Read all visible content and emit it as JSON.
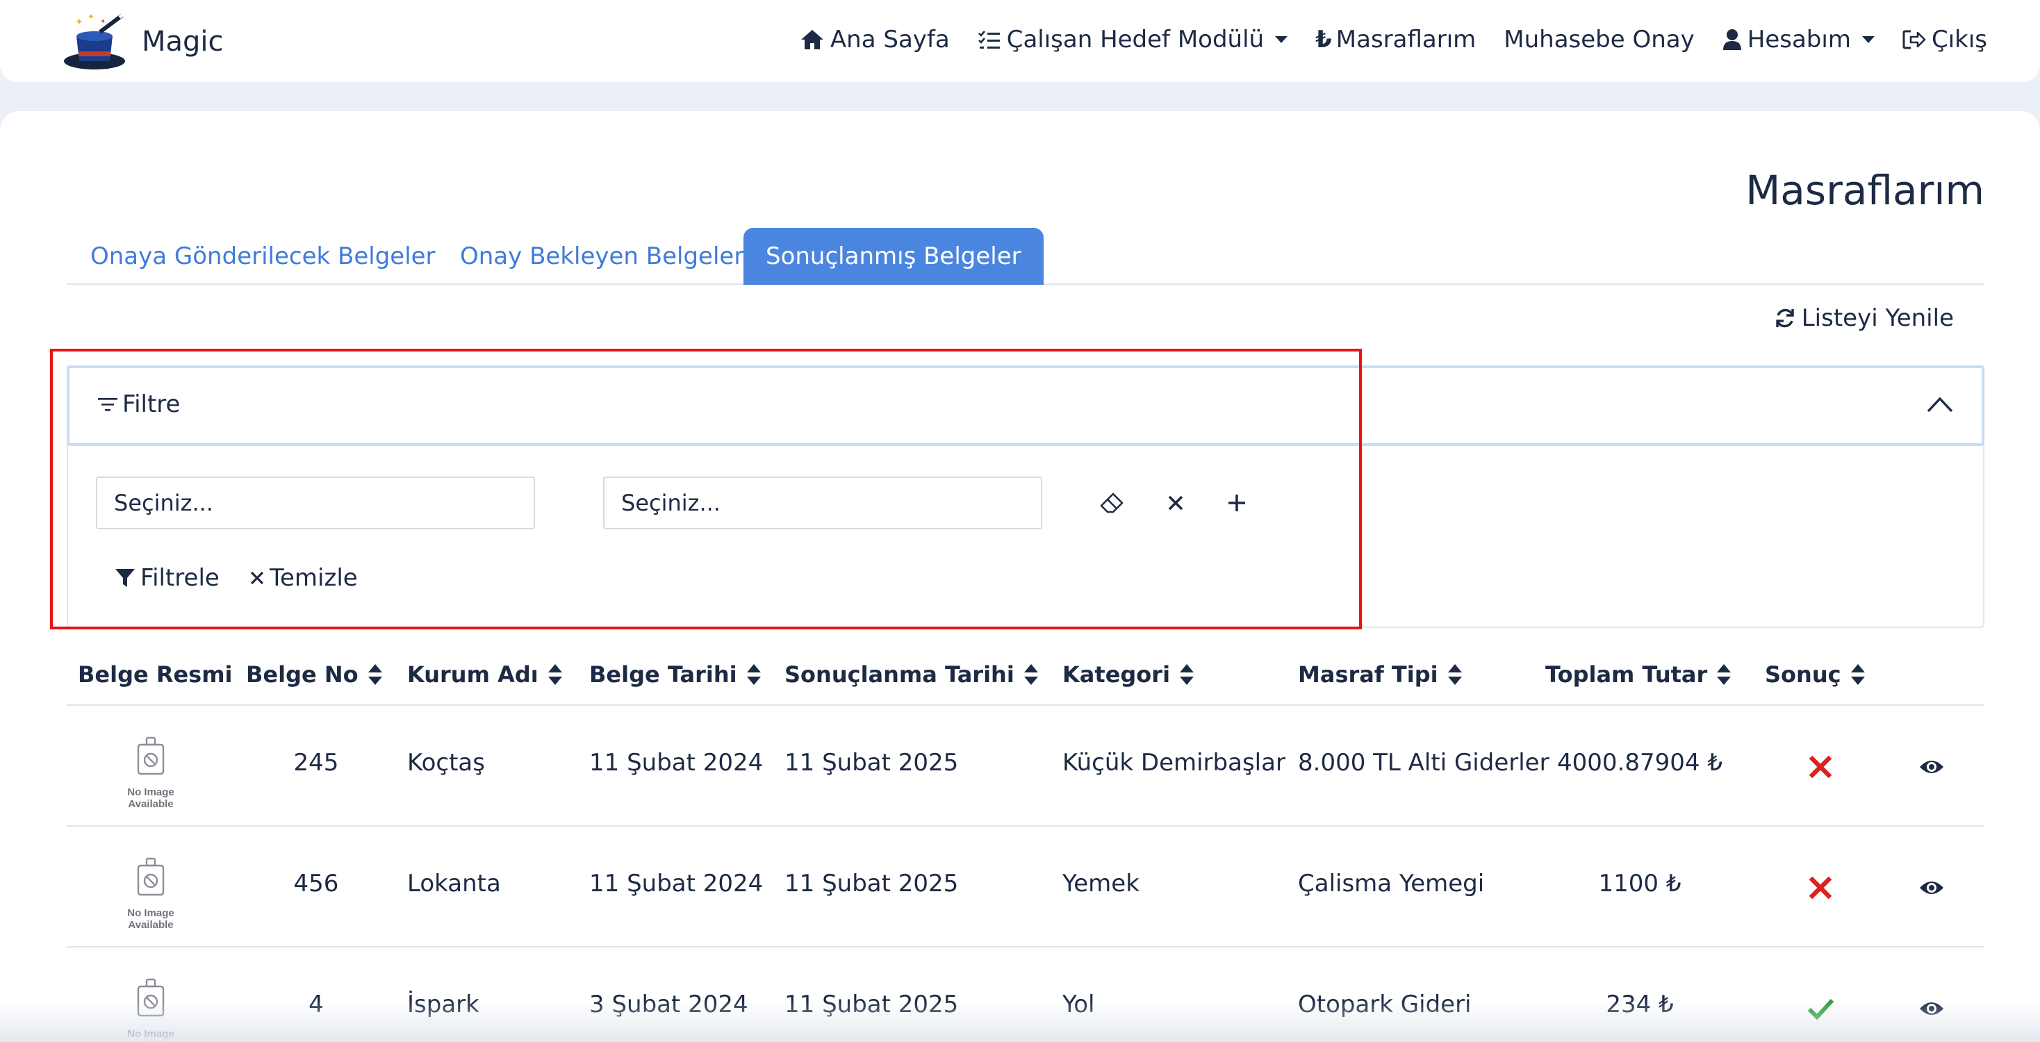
{
  "brand": {
    "name": "Magic"
  },
  "nav": {
    "home": "Ana Sayfa",
    "goals": "Çalışan Hedef Modülü",
    "expenses": "Masraflarım",
    "accounting": "Muhasebe Onay",
    "account": "Hesabım",
    "logout": "Çıkış"
  },
  "page": {
    "title": "Masraflarım"
  },
  "tabs": [
    "Onaya Gönderilecek Belgeler",
    "Onay Bekleyen Belgeler",
    "Sonuçlanmış Belgeler"
  ],
  "refresh_label": "Listeyi Yenile",
  "filter": {
    "title": "Filtre",
    "select1_placeholder": "Seçiniz...",
    "select2_placeholder": "Seçiniz...",
    "apply_label": "Filtrele",
    "clear_label": "Temizle"
  },
  "table": {
    "columns": [
      "Belge Resmi",
      "Belge No",
      "Kurum Adı",
      "Belge Tarihi",
      "Sonuçlanma Tarihi",
      "Kategori",
      "Masraf Tipi",
      "Toplam Tutar",
      "Sonuç"
    ],
    "no_image_text": "No Image Available",
    "rows": [
      {
        "no": "245",
        "institution": "Koçtaş",
        "doc_date": "11 Şubat 2024",
        "result_date": "11 Şubat 2025",
        "category": "Küçük Demirbaşlar",
        "expense_type": "8.000 TL Alti Giderler",
        "total": "4000.87904 ₺",
        "result": "rejected"
      },
      {
        "no": "456",
        "institution": "Lokanta",
        "doc_date": "11 Şubat 2024",
        "result_date": "11 Şubat 2025",
        "category": "Yemek",
        "expense_type": "Çalisma Yemegi",
        "total": "1100 ₺",
        "result": "rejected"
      },
      {
        "no": "4",
        "institution": "İspark",
        "doc_date": "3 Şubat 2024",
        "result_date": "11 Şubat 2025",
        "category": "Yol",
        "expense_type": "Otopark Gideri",
        "total": "234 ₺",
        "result": "approved"
      }
    ]
  },
  "colors": {
    "accent": "#4a86e0",
    "highlight": "#e8140f",
    "reject": "#d9231d",
    "approve": "#2e9b3a"
  }
}
